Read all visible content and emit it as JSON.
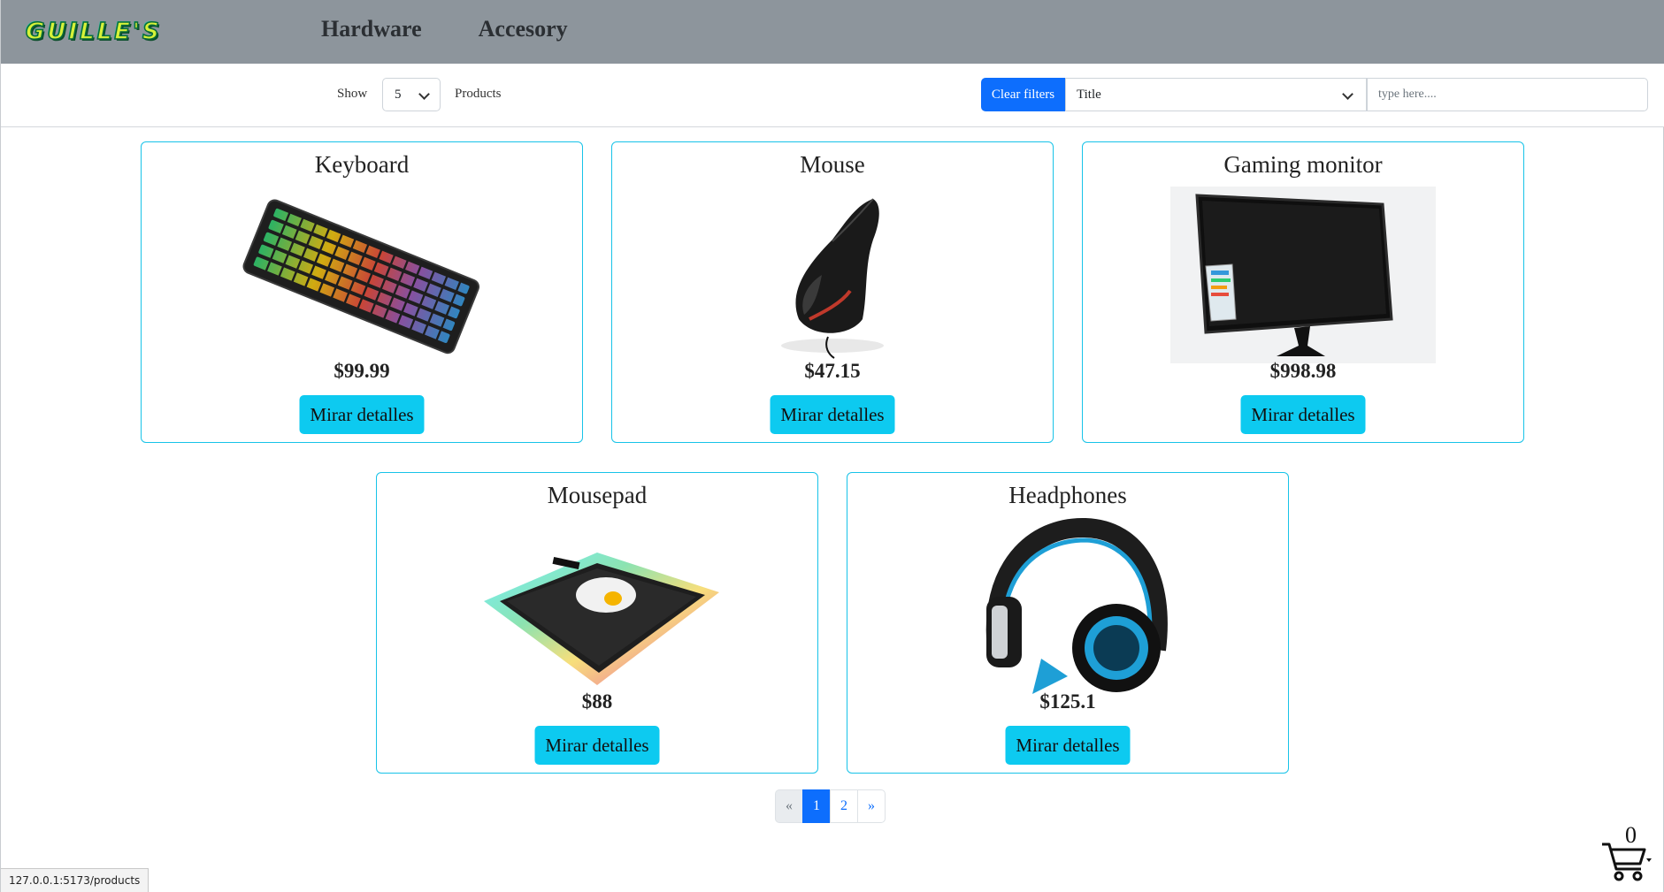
{
  "navbar": {
    "logo_text": "GUILLE'S",
    "links": [
      "Hardware",
      "Accesory"
    ]
  },
  "filters": {
    "show_label": "Show",
    "show_value": "5",
    "products_label": "Products",
    "clear_button": "Clear filters",
    "field_select_value": "Title",
    "search_placeholder": "type here...."
  },
  "products": [
    {
      "title": "Keyboard",
      "price": "$99.99",
      "button": "Mirar detalles",
      "image_icon": "keyboard-image"
    },
    {
      "title": "Mouse",
      "price": "$47.15",
      "button": "Mirar detalles",
      "image_icon": "mouse-image"
    },
    {
      "title": "Gaming monitor",
      "price": "$998.98",
      "button": "Mirar detalles",
      "image_icon": "monitor-image"
    },
    {
      "title": "Mousepad",
      "price": "$88",
      "button": "Mirar detalles",
      "image_icon": "mousepad-image"
    },
    {
      "title": "Headphones",
      "price": "$125.1",
      "button": "Mirar detalles",
      "image_icon": "headphones-image"
    }
  ],
  "pagination": {
    "prev": "«",
    "pages": [
      "1",
      "2"
    ],
    "active": "1",
    "next": "»"
  },
  "cart": {
    "count": "0"
  },
  "status_bar": {
    "url": "127.0.0.1:5173/products"
  },
  "colors": {
    "navbar_bg": "#8d959c",
    "primary": "#0d6efd",
    "info": "#0dcaf0",
    "card_border": "#17c3e8"
  }
}
